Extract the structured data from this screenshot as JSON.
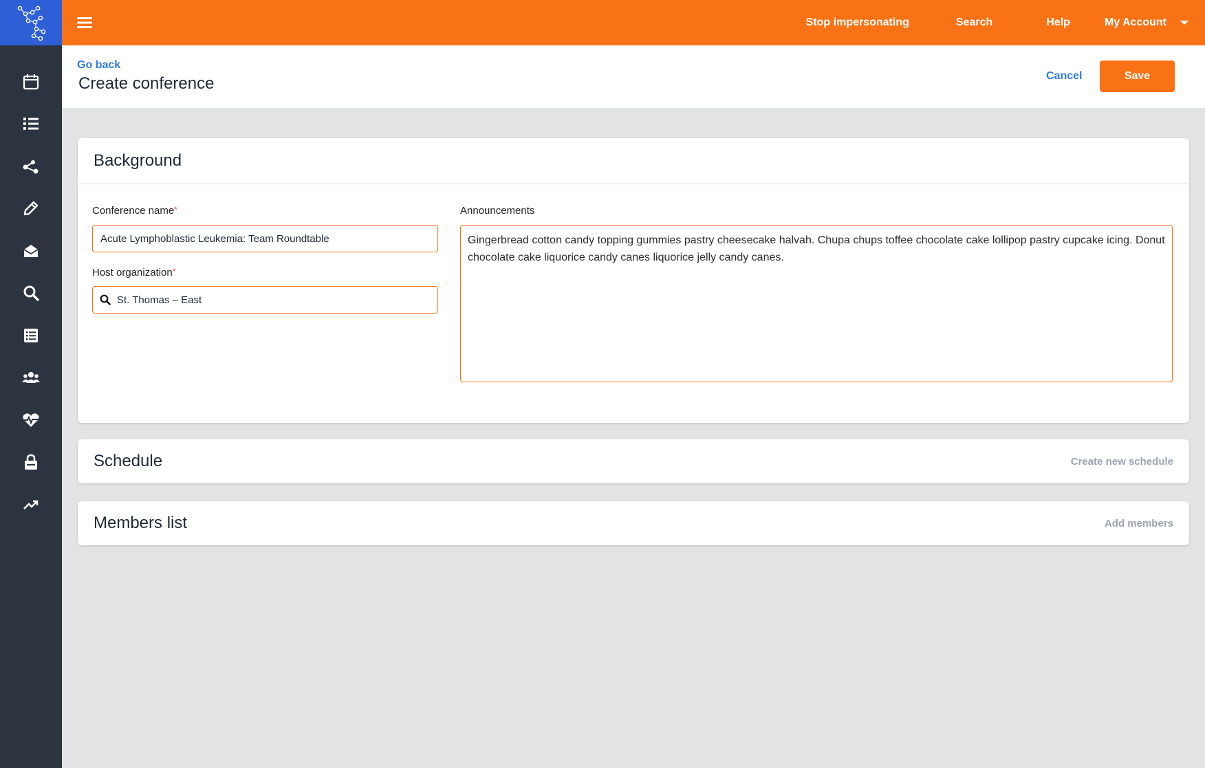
{
  "topbar": {
    "stop_impersonating": "Stop impersonating",
    "search": "Search",
    "help": "Help",
    "my_account": "My Account"
  },
  "sidebar": {
    "items": [
      {
        "icon": "calendar-icon"
      },
      {
        "icon": "list-icon"
      },
      {
        "icon": "share-nodes-icon"
      },
      {
        "icon": "pencil-icon"
      },
      {
        "icon": "envelope-open-icon"
      },
      {
        "icon": "search-icon"
      },
      {
        "icon": "document-list-icon"
      },
      {
        "icon": "users-icon"
      },
      {
        "icon": "heart-pulse-icon"
      },
      {
        "icon": "lock-icon"
      },
      {
        "icon": "trending-up-icon"
      }
    ]
  },
  "header": {
    "go_back": "Go back",
    "title": "Create conference",
    "cancel": "Cancel",
    "save": "Save"
  },
  "background": {
    "title": "Background",
    "conference_name_label": "Conference name",
    "conference_name_value": "Acute Lymphoblastic Leukemia: Team Roundtable",
    "host_org_label": "Host organization",
    "host_org_value": "St. Thomas – East",
    "announcements_label": "Announcements",
    "announcements_value": "Gingerbread cotton candy topping gummies pastry cheesecake halvah. Chupa chups toffee chocolate cake lollipop pastry cupcake icing. Donut chocolate cake liquorice candy canes liquorice jelly candy canes.",
    "required_mark": "*"
  },
  "schedule": {
    "title": "Schedule",
    "action": "Create new schedule"
  },
  "members": {
    "title": "Members list",
    "action": "Add members"
  },
  "colors": {
    "accent": "#f97316",
    "link": "#2f7be5",
    "sidebar": "#2c3440",
    "logo_bg": "#2f5fd6"
  }
}
